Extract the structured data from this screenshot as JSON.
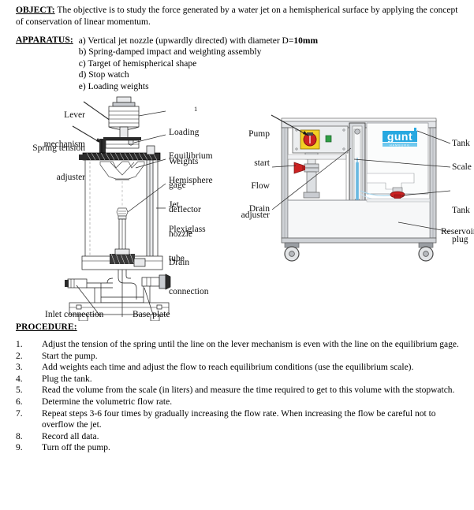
{
  "document": {
    "object": {
      "heading": "OBJECT:",
      "text": "The objective is to study the force generated by a water jet on a hemispherical surface by applying the concept of conservation of linear momentum."
    },
    "apparatus": {
      "heading": "APPARATUS:",
      "items": [
        {
          "marker": "a)",
          "text": "Vertical jet nozzle (upwardly directed) with diameter D=",
          "bold": "10mm"
        },
        {
          "marker": "b)",
          "text": "Spring-damped impact and weighting assembly",
          "bold": ""
        },
        {
          "marker": "c)",
          "text": "Target of hemispherical shape",
          "bold": ""
        },
        {
          "marker": "d)",
          "text": "Stop watch",
          "bold": ""
        },
        {
          "marker": "e)",
          "text": "Loading weights",
          "bold": ""
        }
      ]
    },
    "procedure": {
      "heading": "PROCEDURE:",
      "steps": [
        {
          "number": "1.",
          "text": "Adjust the tension of the spring until the line on the lever mechanism is even with the line on the equilibrium gage."
        },
        {
          "number": "2.",
          "text": "Start the pump."
        },
        {
          "number": "3.",
          "text": "Add weights each time and adjust the flow to reach equilibrium conditions (use the equilibrium scale)."
        },
        {
          "number": "4.",
          "text": "Plug the tank."
        },
        {
          "number": "5.",
          "text": "Read the volume from the scale (in liters) and measure the time required to get to this volume with the stopwatch."
        },
        {
          "number": "6.",
          "text": "Determine the volumetric flow rate."
        },
        {
          "number": "7.",
          "text": "Repeat steps 3-6 four times by gradually increasing the flow rate. When increasing the flow be careful not to overflow the jet."
        },
        {
          "number": "8.",
          "text": "Record all data."
        },
        {
          "number": "9.",
          "text": "Turn off the pump."
        }
      ]
    }
  },
  "figures": {
    "left": {
      "figure_number": "1",
      "callouts_left": [
        {
          "id": "lever-mechanism",
          "line1": "Lever",
          "line2": "mechanism"
        },
        {
          "id": "spring-tension-adjuster",
          "line1": "Spring tension",
          "line2": "adjuster"
        }
      ],
      "callouts_right": [
        {
          "id": "loading-weights",
          "line1": "Loading",
          "line2": "Weights"
        },
        {
          "id": "equilibrium-gage",
          "line1": "Equilibrium",
          "line2": "gage"
        },
        {
          "id": "hemisphere-deflector",
          "line1": "Hemisphere",
          "line2": "deflector"
        },
        {
          "id": "jet-nozzle",
          "line1": "Jet",
          "line2": "nozzle"
        },
        {
          "id": "plexiglass-tube",
          "line1": "Plexiglass",
          "line2": "tube"
        },
        {
          "id": "drain-connection",
          "line1": "Drain",
          "line2": "connection"
        }
      ],
      "callouts_bottom": [
        {
          "id": "inlet-connection",
          "line1": "Inlet connection",
          "line2": ""
        },
        {
          "id": "base-plate",
          "line1": "Base plate",
          "line2": ""
        }
      ]
    },
    "right": {
      "brand_logo": "gunt",
      "brand_sub": "HAMBURG",
      "callouts_left": [
        {
          "id": "pump-start",
          "line1": "Pump",
          "line2": "start"
        },
        {
          "id": "flow-adjuster",
          "line1": "Flow",
          "line2": "adjuster"
        },
        {
          "id": "drain",
          "line1": "Drain",
          "line2": ""
        }
      ],
      "callouts_right": [
        {
          "id": "tank",
          "line1": "Tank",
          "line2": ""
        },
        {
          "id": "scale",
          "line1": "Scale",
          "line2": ""
        },
        {
          "id": "tank-plug",
          "line1": "Tank",
          "line2": "plug"
        },
        {
          "id": "reservoir",
          "line1": "Reservoir",
          "line2": ""
        }
      ]
    }
  },
  "colors": {
    "brand_cyan": "#28a8e0",
    "pump_yellow": "#f2d024",
    "valve_red": "#cc2222",
    "indicator_green": "#2f9e44",
    "water_blue": "#8fcde8",
    "frame_gray": "#c9ccd1",
    "ink": "#1a1a1a"
  }
}
